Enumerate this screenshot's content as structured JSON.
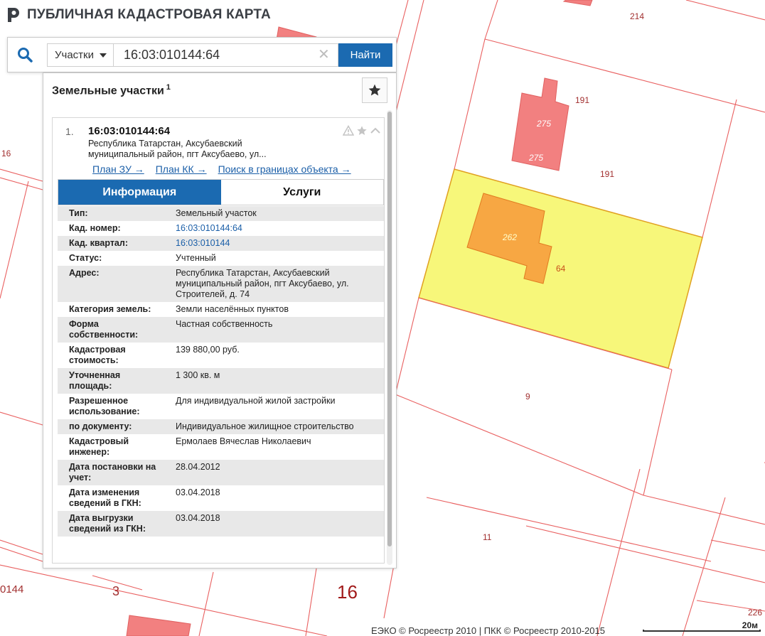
{
  "header": {
    "title": "ПУБЛИЧНАЯ КАДАСТРОВАЯ КАРТА"
  },
  "search": {
    "type_label": "Участки",
    "query": "16:03:010144:64",
    "clear_glyph": "✕",
    "submit_label": "Найти"
  },
  "panel": {
    "title": "Земельные участки",
    "count": "1"
  },
  "result": {
    "index": "1.",
    "cad_number": "16:03:010144:64",
    "address_short": "Республика Татарстан, Аксубаевский муниципальный район, пгт Аксубаево, ул...",
    "links": [
      "План ЗУ →",
      "План КК →",
      "Поиск в границах объекта →"
    ]
  },
  "tabs": [
    "Информация",
    "Услуги"
  ],
  "info_rows": [
    {
      "k": "Тип:",
      "v": "Земельный участок",
      "link": false
    },
    {
      "k": "Кад. номер:",
      "v": "16:03:010144:64",
      "link": true
    },
    {
      "k": "Кад. квартал:",
      "v": "16:03:010144",
      "link": true
    },
    {
      "k": "Статус:",
      "v": "Учтенный",
      "link": false
    },
    {
      "k": "Адрес:",
      "v": "Республика Татарстан, Аксубаевский муниципальный район, пгт Аксубаево, ул. Строителей, д. 74",
      "link": false
    },
    {
      "k": "Категория земель:",
      "v": "Земли населённых пунктов",
      "link": false
    },
    {
      "k": "Форма собственности:",
      "v": "Частная собственность",
      "link": false
    },
    {
      "k": "Кадастровая стоимость:",
      "v": "139 880,00 руб.",
      "link": false
    },
    {
      "k": "Уточненная площадь:",
      "v": "1 300 кв. м",
      "link": false
    },
    {
      "k": "Разрешенное использование:",
      "v": "Для индивидуальной жилой застройки",
      "link": false
    },
    {
      "k": "по документу:",
      "v": "Индивидуальное жилищное строительство",
      "link": false
    },
    {
      "k": "Кадастровый инженер:",
      "v": "Ермолаев Вячеслав Николаевич",
      "link": false
    },
    {
      "k": "Дата постановки на учет:",
      "v": "28.04.2012",
      "link": false
    },
    {
      "k": "Дата изменения сведений в ГКН:",
      "v": "03.04.2018",
      "link": false
    },
    {
      "k": "Дата выгрузки сведений из ГКН:",
      "v": "03.04.2018",
      "link": false
    }
  ],
  "map_labels": {
    "l214": "214",
    "l191a": "191",
    "l191b": "191",
    "l275a": "275",
    "l275b": "275",
    "l262": "262",
    "l64": "64",
    "l9": "9",
    "l11": "11",
    "l16a": "16",
    "l3": "3",
    "l16b": "16",
    "l0144": "0144",
    "l226": "226"
  },
  "map_colors": {
    "selected_fill": "#f7f77a",
    "building_fill": "#f28080",
    "selected_building_fill": "#f7a743",
    "boundary": "#e96060"
  },
  "footer": {
    "attribution": "ЕЭКО © Росреестр 2010 | ПКК © Росреестр 2010-2015",
    "scale": "20м"
  }
}
